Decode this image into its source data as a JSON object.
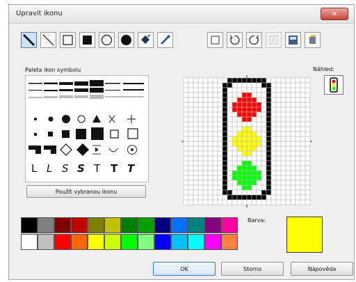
{
  "window": {
    "title": "Upravit ikonu",
    "close_label": "×"
  },
  "toolbar": {
    "tools": [
      {
        "name": "line-thick-tool",
        "icon": "diagonal-line-thick-icon"
      },
      {
        "name": "line-thin-tool",
        "icon": "diagonal-line-thin-icon"
      },
      {
        "name": "rect-outline-tool",
        "icon": "rectangle-outline-icon"
      },
      {
        "name": "rect-filled-tool",
        "icon": "rectangle-filled-icon"
      },
      {
        "name": "circle-outline-tool",
        "icon": "circle-outline-icon"
      },
      {
        "name": "circle-filled-tool",
        "icon": "circle-filled-icon"
      },
      {
        "name": "fill-tool",
        "icon": "paint-bucket-icon"
      },
      {
        "name": "eyedropper-tool",
        "icon": "eyedropper-icon"
      }
    ],
    "actions": [
      {
        "name": "clear-action",
        "icon": "blank-page-icon"
      },
      {
        "name": "rotate-left-action",
        "icon": "rotate-left-icon"
      },
      {
        "name": "rotate-right-action",
        "icon": "rotate-right-icon"
      },
      {
        "name": "disabled-action",
        "icon": "grid-disabled-icon"
      },
      {
        "name": "save-action",
        "icon": "save-icon"
      },
      {
        "name": "paint-action",
        "icon": "paint-can-icon"
      }
    ]
  },
  "palette": {
    "label": "Paleta ikon symbolu",
    "use_button": "Použít vybranou ikonu",
    "letters": [
      "L",
      "L",
      "S",
      "S",
      "T",
      "T",
      "T"
    ]
  },
  "preview": {
    "label": "Náhled:"
  },
  "colors": {
    "row1": [
      "#000000",
      "#808080",
      "#800000",
      "#c00000",
      "#808000",
      "#c0c000",
      "#008000",
      "#00a000",
      "#000080",
      "#0070ff",
      "#008080",
      "#800080",
      "#ff00a0"
    ],
    "row2": [
      "#ffffff",
      "#c0c0c0",
      "#ff0000",
      "#ff6600",
      "#ffff00",
      "#ccff00",
      "#00ff00",
      "#80ff80",
      "#0000ff",
      "#00c0ff",
      "#00ffff",
      "#ff00ff",
      "#ff8040"
    ],
    "selected_color_label": "Barva:",
    "selected_color": "#ffff00"
  },
  "icon_colors": {
    "frame": "#000000",
    "red": "#ff0000",
    "yellow": "#ffff00",
    "green": "#00ff00"
  },
  "buttons": {
    "ok": "OK",
    "cancel": "Storno",
    "help": "Nápověda"
  }
}
